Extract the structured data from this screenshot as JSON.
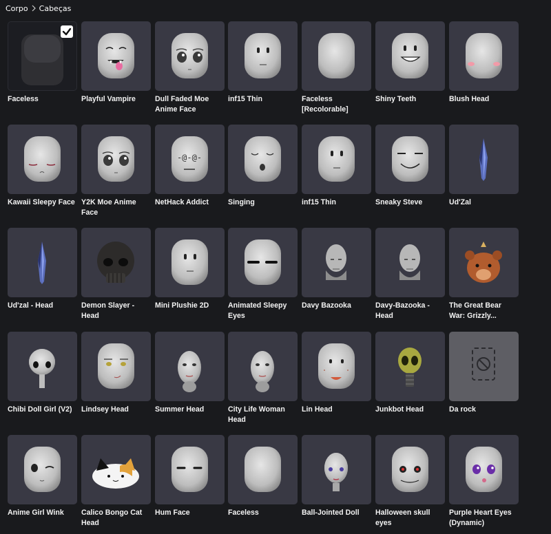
{
  "breadcrumb": {
    "root": "Corpo",
    "current": "Cabeças"
  },
  "items": [
    {
      "label": "Faceless",
      "selected": true,
      "face": "blank-dark"
    },
    {
      "label": "Playful Vampire",
      "face": "vampire"
    },
    {
      "label": "Dull Faded Moe Anime Face",
      "face": "anime"
    },
    {
      "label": "inf15 Thin",
      "face": "dots"
    },
    {
      "label": "Faceless [Recolorable]",
      "face": "blank"
    },
    {
      "label": "Shiny Teeth",
      "face": "teeth"
    },
    {
      "label": "Blush Head",
      "face": "blush"
    },
    {
      "label": "Kawaii Sleepy Face",
      "face": "sleepy"
    },
    {
      "label": "Y2K Moe Anime Face",
      "face": "anime"
    },
    {
      "label": "NetHack Addict",
      "face": "nethack"
    },
    {
      "label": "Singing",
      "face": "singing"
    },
    {
      "label": "inf15 Thin",
      "face": "dots"
    },
    {
      "label": "Sneaky Steve",
      "face": "sneaky"
    },
    {
      "label": "Ud'Zal",
      "face": "crystal"
    },
    {
      "label": "Ud'zal - Head",
      "face": "crystal"
    },
    {
      "label": "Demon Slayer - Head",
      "face": "skull"
    },
    {
      "label": "Mini Plushie 2D",
      "face": "dots"
    },
    {
      "label": "Animated Sleepy Eyes",
      "face": "sleepyeyes"
    },
    {
      "label": "Davy Bazooka",
      "face": "bald"
    },
    {
      "label": "Davy-Bazooka - Head",
      "face": "bald"
    },
    {
      "label": "The Great Bear War: Grizzly...",
      "face": "bear"
    },
    {
      "label": "Chibi Doll Girl (V2)",
      "face": "chibi"
    },
    {
      "label": "Lindsey Head",
      "face": "lindsey"
    },
    {
      "label": "Summer Head",
      "face": "human"
    },
    {
      "label": "City Life Woman Head",
      "face": "human"
    },
    {
      "label": "Lin Head",
      "face": "lin"
    },
    {
      "label": "Junkbot Head",
      "face": "junkbot"
    },
    {
      "label": "Da rock",
      "face": "missing"
    },
    {
      "label": "Anime Girl Wink",
      "face": "wink"
    },
    {
      "label": "Calico Bongo Cat Head",
      "face": "cat"
    },
    {
      "label": "Hum Face",
      "face": "hum"
    },
    {
      "label": "Faceless",
      "face": "blank"
    },
    {
      "label": "Ball-Jointed Doll",
      "face": "doll"
    },
    {
      "label": "Halloween skull eyes",
      "face": "halloween"
    },
    {
      "label": "Purple Heart Eyes (Dynamic)",
      "face": "purple"
    }
  ],
  "colors": {
    "background": "#191a1d",
    "card": "#393944",
    "card_selected": "#1c1d22",
    "card_missing": "#5e5e64",
    "head": "#bdbdbd",
    "text": "#f2f2f2"
  }
}
